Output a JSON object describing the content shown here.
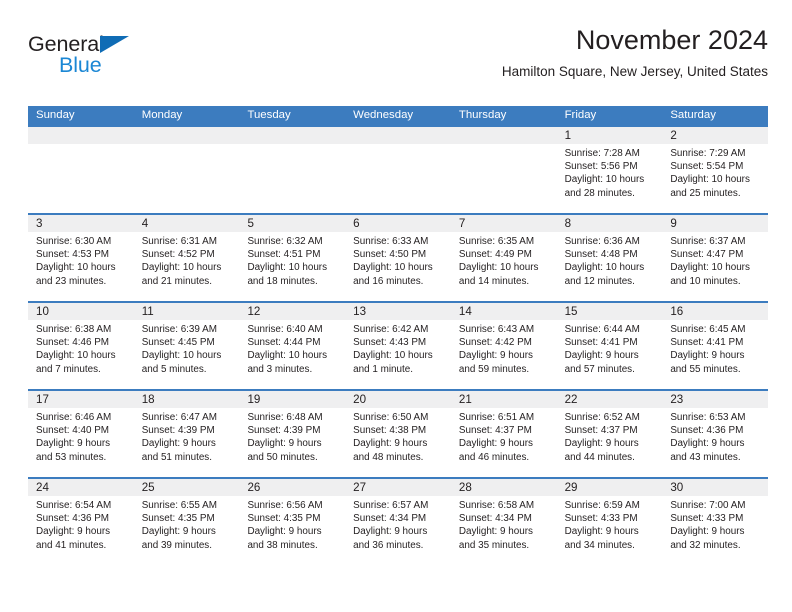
{
  "brand": {
    "name_part1": "General",
    "name_part2": "Blue",
    "triangle_icon": "triangle-icon",
    "color_dark": "#231f20",
    "color_blue": "#1b87d4",
    "triangle_color": "#0f6cb5"
  },
  "header": {
    "title": "November 2024",
    "subtitle": "Hamilton Square, New Jersey, United States"
  },
  "theme": {
    "header_blue": "#3c7cbf",
    "date_band_gray": "#efeff0",
    "text": "#231f20"
  },
  "weekdays": [
    "Sunday",
    "Monday",
    "Tuesday",
    "Wednesday",
    "Thursday",
    "Friday",
    "Saturday"
  ],
  "weeks": [
    [
      {
        "day": "",
        "sunrise": "",
        "sunset": "",
        "daylight1": "",
        "daylight2": ""
      },
      {
        "day": "",
        "sunrise": "",
        "sunset": "",
        "daylight1": "",
        "daylight2": ""
      },
      {
        "day": "",
        "sunrise": "",
        "sunset": "",
        "daylight1": "",
        "daylight2": ""
      },
      {
        "day": "",
        "sunrise": "",
        "sunset": "",
        "daylight1": "",
        "daylight2": ""
      },
      {
        "day": "",
        "sunrise": "",
        "sunset": "",
        "daylight1": "",
        "daylight2": ""
      },
      {
        "day": "1",
        "sunrise": "Sunrise: 7:28 AM",
        "sunset": "Sunset: 5:56 PM",
        "daylight1": "Daylight: 10 hours",
        "daylight2": "and 28 minutes."
      },
      {
        "day": "2",
        "sunrise": "Sunrise: 7:29 AM",
        "sunset": "Sunset: 5:54 PM",
        "daylight1": "Daylight: 10 hours",
        "daylight2": "and 25 minutes."
      }
    ],
    [
      {
        "day": "3",
        "sunrise": "Sunrise: 6:30 AM",
        "sunset": "Sunset: 4:53 PM",
        "daylight1": "Daylight: 10 hours",
        "daylight2": "and 23 minutes."
      },
      {
        "day": "4",
        "sunrise": "Sunrise: 6:31 AM",
        "sunset": "Sunset: 4:52 PM",
        "daylight1": "Daylight: 10 hours",
        "daylight2": "and 21 minutes."
      },
      {
        "day": "5",
        "sunrise": "Sunrise: 6:32 AM",
        "sunset": "Sunset: 4:51 PM",
        "daylight1": "Daylight: 10 hours",
        "daylight2": "and 18 minutes."
      },
      {
        "day": "6",
        "sunrise": "Sunrise: 6:33 AM",
        "sunset": "Sunset: 4:50 PM",
        "daylight1": "Daylight: 10 hours",
        "daylight2": "and 16 minutes."
      },
      {
        "day": "7",
        "sunrise": "Sunrise: 6:35 AM",
        "sunset": "Sunset: 4:49 PM",
        "daylight1": "Daylight: 10 hours",
        "daylight2": "and 14 minutes."
      },
      {
        "day": "8",
        "sunrise": "Sunrise: 6:36 AM",
        "sunset": "Sunset: 4:48 PM",
        "daylight1": "Daylight: 10 hours",
        "daylight2": "and 12 minutes."
      },
      {
        "day": "9",
        "sunrise": "Sunrise: 6:37 AM",
        "sunset": "Sunset: 4:47 PM",
        "daylight1": "Daylight: 10 hours",
        "daylight2": "and 10 minutes."
      }
    ],
    [
      {
        "day": "10",
        "sunrise": "Sunrise: 6:38 AM",
        "sunset": "Sunset: 4:46 PM",
        "daylight1": "Daylight: 10 hours",
        "daylight2": "and 7 minutes."
      },
      {
        "day": "11",
        "sunrise": "Sunrise: 6:39 AM",
        "sunset": "Sunset: 4:45 PM",
        "daylight1": "Daylight: 10 hours",
        "daylight2": "and 5 minutes."
      },
      {
        "day": "12",
        "sunrise": "Sunrise: 6:40 AM",
        "sunset": "Sunset: 4:44 PM",
        "daylight1": "Daylight: 10 hours",
        "daylight2": "and 3 minutes."
      },
      {
        "day": "13",
        "sunrise": "Sunrise: 6:42 AM",
        "sunset": "Sunset: 4:43 PM",
        "daylight1": "Daylight: 10 hours",
        "daylight2": "and 1 minute."
      },
      {
        "day": "14",
        "sunrise": "Sunrise: 6:43 AM",
        "sunset": "Sunset: 4:42 PM",
        "daylight1": "Daylight: 9 hours",
        "daylight2": "and 59 minutes."
      },
      {
        "day": "15",
        "sunrise": "Sunrise: 6:44 AM",
        "sunset": "Sunset: 4:41 PM",
        "daylight1": "Daylight: 9 hours",
        "daylight2": "and 57 minutes."
      },
      {
        "day": "16",
        "sunrise": "Sunrise: 6:45 AM",
        "sunset": "Sunset: 4:41 PM",
        "daylight1": "Daylight: 9 hours",
        "daylight2": "and 55 minutes."
      }
    ],
    [
      {
        "day": "17",
        "sunrise": "Sunrise: 6:46 AM",
        "sunset": "Sunset: 4:40 PM",
        "daylight1": "Daylight: 9 hours",
        "daylight2": "and 53 minutes."
      },
      {
        "day": "18",
        "sunrise": "Sunrise: 6:47 AM",
        "sunset": "Sunset: 4:39 PM",
        "daylight1": "Daylight: 9 hours",
        "daylight2": "and 51 minutes."
      },
      {
        "day": "19",
        "sunrise": "Sunrise: 6:48 AM",
        "sunset": "Sunset: 4:39 PM",
        "daylight1": "Daylight: 9 hours",
        "daylight2": "and 50 minutes."
      },
      {
        "day": "20",
        "sunrise": "Sunrise: 6:50 AM",
        "sunset": "Sunset: 4:38 PM",
        "daylight1": "Daylight: 9 hours",
        "daylight2": "and 48 minutes."
      },
      {
        "day": "21",
        "sunrise": "Sunrise: 6:51 AM",
        "sunset": "Sunset: 4:37 PM",
        "daylight1": "Daylight: 9 hours",
        "daylight2": "and 46 minutes."
      },
      {
        "day": "22",
        "sunrise": "Sunrise: 6:52 AM",
        "sunset": "Sunset: 4:37 PM",
        "daylight1": "Daylight: 9 hours",
        "daylight2": "and 44 minutes."
      },
      {
        "day": "23",
        "sunrise": "Sunrise: 6:53 AM",
        "sunset": "Sunset: 4:36 PM",
        "daylight1": "Daylight: 9 hours",
        "daylight2": "and 43 minutes."
      }
    ],
    [
      {
        "day": "24",
        "sunrise": "Sunrise: 6:54 AM",
        "sunset": "Sunset: 4:36 PM",
        "daylight1": "Daylight: 9 hours",
        "daylight2": "and 41 minutes."
      },
      {
        "day": "25",
        "sunrise": "Sunrise: 6:55 AM",
        "sunset": "Sunset: 4:35 PM",
        "daylight1": "Daylight: 9 hours",
        "daylight2": "and 39 minutes."
      },
      {
        "day": "26",
        "sunrise": "Sunrise: 6:56 AM",
        "sunset": "Sunset: 4:35 PM",
        "daylight1": "Daylight: 9 hours",
        "daylight2": "and 38 minutes."
      },
      {
        "day": "27",
        "sunrise": "Sunrise: 6:57 AM",
        "sunset": "Sunset: 4:34 PM",
        "daylight1": "Daylight: 9 hours",
        "daylight2": "and 36 minutes."
      },
      {
        "day": "28",
        "sunrise": "Sunrise: 6:58 AM",
        "sunset": "Sunset: 4:34 PM",
        "daylight1": "Daylight: 9 hours",
        "daylight2": "and 35 minutes."
      },
      {
        "day": "29",
        "sunrise": "Sunrise: 6:59 AM",
        "sunset": "Sunset: 4:33 PM",
        "daylight1": "Daylight: 9 hours",
        "daylight2": "and 34 minutes."
      },
      {
        "day": "30",
        "sunrise": "Sunrise: 7:00 AM",
        "sunset": "Sunset: 4:33 PM",
        "daylight1": "Daylight: 9 hours",
        "daylight2": "and 32 minutes."
      }
    ]
  ]
}
